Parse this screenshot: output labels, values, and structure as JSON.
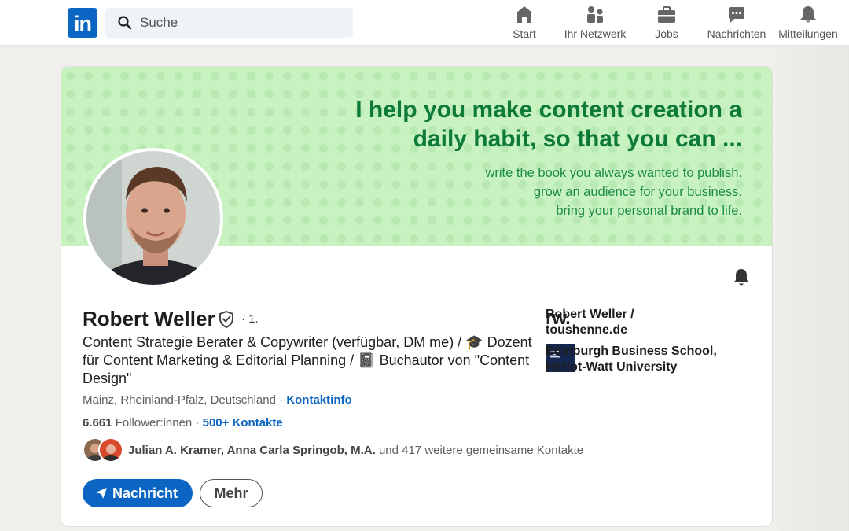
{
  "nav": {
    "logo_text": "in",
    "search_placeholder": "Suche",
    "items": [
      {
        "label": "Start",
        "icon": "home-icon"
      },
      {
        "label": "Ihr Netzwerk",
        "icon": "network-icon"
      },
      {
        "label": "Jobs",
        "icon": "briefcase-icon"
      },
      {
        "label": "Nachrichten",
        "icon": "messaging-icon"
      },
      {
        "label": "Mitteilungen",
        "icon": "bell-icon"
      }
    ]
  },
  "banner": {
    "headline_1": "I help you make content creation a",
    "headline_2": "daily habit, so that you can ...",
    "line_1": "write the book you always wanted to publish.",
    "line_2": "grow an audience for your business.",
    "line_3": "bring your personal brand to life."
  },
  "profile": {
    "name": "Robert Weller",
    "degree": "· 1.",
    "headline": "Content Strategie Berater & Copywriter (verfügbar, DM me) / 🎓 Dozent für Content Marketing & Editorial Planning / 📓 Buchautor von \"Content Design\"",
    "location": "Mainz, Rheinland-Pfalz, Deutschland",
    "location_sep": " · ",
    "contact_info": "Kontaktinfo",
    "followers_count": "6.661",
    "followers_label": " Follower:innen",
    "followers_sep": " · ",
    "connections": "500+ Kontakte",
    "mutual_names": "Julian A. Kramer, Anna Carla Springob, M.A.",
    "mutual_rest": " und 417 weitere gemeinsame Kontakte"
  },
  "actions": {
    "message": "Nachricht",
    "more": "Mehr"
  },
  "organizations": [
    {
      "logo_text": "rw.",
      "name": "Robert Weller / toushenne.de"
    },
    {
      "name": "Edinburgh Business School, Heriot-Watt University"
    }
  ],
  "colors": {
    "brand": "#0a66c2",
    "banner_bg": "#c9f2c1",
    "banner_text": "#0d7a3a"
  }
}
